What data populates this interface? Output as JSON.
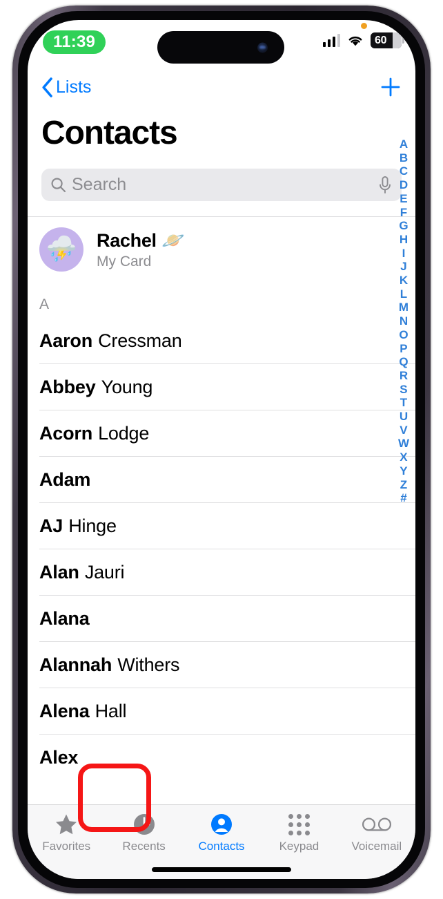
{
  "status_bar": {
    "time": "11:39",
    "time_pill_color": "#30d158",
    "cellular_icon": "cellular-bars-icon",
    "wifi_icon": "wifi-icon",
    "battery_level": "60",
    "mic_indicator": "orange-dot"
  },
  "nav": {
    "back_label": "Lists",
    "back_icon": "chevron-left-icon",
    "add_icon": "plus-icon",
    "accent_color": "#007aff"
  },
  "header": {
    "title": "Contacts"
  },
  "search": {
    "placeholder": "Search",
    "search_icon": "magnifying-glass-icon",
    "dictation_icon": "microphone-icon"
  },
  "my_card": {
    "avatar_emoji": "⛈️",
    "avatar_bg": "#c5b3ec",
    "name": "Rachel 🪐",
    "label": "My Card"
  },
  "list": {
    "section_header": "A",
    "contacts": [
      {
        "first": "Aaron",
        "last": "Cressman"
      },
      {
        "first": "Abbey",
        "last": "Young"
      },
      {
        "first": "Acorn",
        "last": "Lodge"
      },
      {
        "first": "Adam",
        "last": ""
      },
      {
        "first": "AJ",
        "last": "Hinge"
      },
      {
        "first": "Alan",
        "last": "Jauri"
      },
      {
        "first": "Alana",
        "last": ""
      },
      {
        "first": "Alannah",
        "last": "Withers"
      },
      {
        "first": "Alena",
        "last": "Hall"
      },
      {
        "first": "Alex",
        "last": ""
      }
    ]
  },
  "alpha_index": {
    "color": "#2f7fd8",
    "letters": [
      "A",
      "B",
      "C",
      "D",
      "E",
      "F",
      "G",
      "H",
      "I",
      "J",
      "K",
      "L",
      "M",
      "N",
      "O",
      "P",
      "Q",
      "R",
      "S",
      "T",
      "U",
      "V",
      "W",
      "X",
      "Y",
      "Z",
      "#"
    ]
  },
  "tab_bar": {
    "active_tab": "Contacts",
    "active_color": "#007aff",
    "inactive_color": "#8a8a8e",
    "tabs": [
      {
        "label": "Favorites",
        "icon": "star-icon"
      },
      {
        "label": "Recents",
        "icon": "clock-icon"
      },
      {
        "label": "Contacts",
        "icon": "person-circle-icon"
      },
      {
        "label": "Keypad",
        "icon": "keypad-dots-icon"
      },
      {
        "label": "Voicemail",
        "icon": "voicemail-icon"
      }
    ]
  },
  "annotation": {
    "target_tab": "Recents",
    "color": "#f51616",
    "shape": "rounded-rectangle-outline"
  }
}
